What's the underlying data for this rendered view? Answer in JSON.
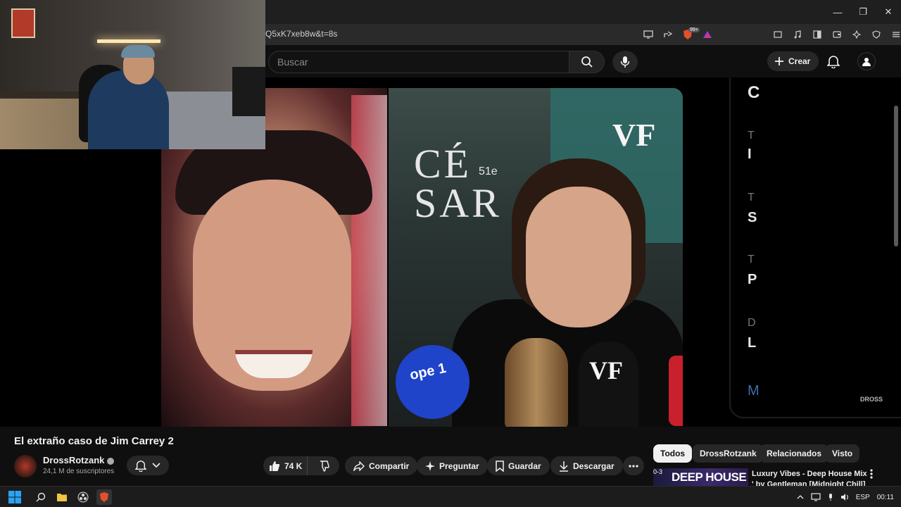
{
  "browser": {
    "url": "Q5xK7xeb8w&t=8s",
    "window_controls": [
      "—",
      "❐",
      "✕"
    ],
    "brave_badge": "99+"
  },
  "header": {
    "search_placeholder": "Buscar",
    "create_label": "Crear"
  },
  "player": {
    "left_frame_text": "",
    "right_frame": {
      "cesar_text": "CÉ\nSAR",
      "edition": "51e",
      "vf_text": "VF",
      "mic_label": "ope 1",
      "mic2_label": "VF"
    },
    "chapter_panel": {
      "top_letter": "C",
      "items": [
        {
          "sub": "T",
          "title": "I"
        },
        {
          "sub": "T",
          "title": "S"
        },
        {
          "sub": "T",
          "title": "P"
        },
        {
          "sub": "D",
          "title": "L"
        },
        {
          "sub": "",
          "title": "M"
        }
      ]
    },
    "watermark": "DROSS"
  },
  "video": {
    "title": "El extraño caso de Jim Carrey 2",
    "channel_name": "DrossRotzank",
    "subscribers": "24,1 M de suscriptores",
    "likes": "74 K",
    "share_label": "Compartir",
    "ask_label": "Preguntar",
    "save_label": "Guardar",
    "download_label": "Descargar"
  },
  "filters": [
    "Todos",
    "DrossRotzank",
    "Relacionados",
    "Visto"
  ],
  "recommendation": {
    "thumb_tag": "0-3",
    "thumb_text": "DEEP HOUSE",
    "title": "Luxury Vibes - Deep House Mix ' by Gentleman [Midnight Chill] ..."
  },
  "taskbar": {
    "language": "ESP",
    "time": "00:11"
  },
  "colors": {
    "yt_bg": "#0f0f0f",
    "chip_bg": "#272727",
    "accent_red": "#ff0000"
  }
}
